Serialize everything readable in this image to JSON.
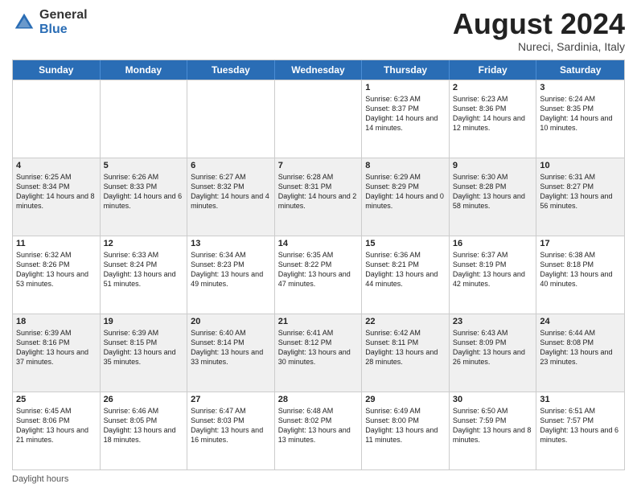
{
  "header": {
    "logo_general": "General",
    "logo_blue": "Blue",
    "title": "August 2024",
    "location": "Nureci, Sardinia, Italy"
  },
  "calendar": {
    "days_of_week": [
      "Sunday",
      "Monday",
      "Tuesday",
      "Wednesday",
      "Thursday",
      "Friday",
      "Saturday"
    ],
    "rows": [
      [
        {
          "day": "",
          "info": "",
          "empty": true
        },
        {
          "day": "",
          "info": "",
          "empty": true
        },
        {
          "day": "",
          "info": "",
          "empty": true
        },
        {
          "day": "",
          "info": "",
          "empty": true
        },
        {
          "day": "1",
          "info": "Sunrise: 6:23 AM\nSunset: 8:37 PM\nDaylight: 14 hours\nand 14 minutes.",
          "empty": false
        },
        {
          "day": "2",
          "info": "Sunrise: 6:23 AM\nSunset: 8:36 PM\nDaylight: 14 hours\nand 12 minutes.",
          "empty": false
        },
        {
          "day": "3",
          "info": "Sunrise: 6:24 AM\nSunset: 8:35 PM\nDaylight: 14 hours\nand 10 minutes.",
          "empty": false
        }
      ],
      [
        {
          "day": "4",
          "info": "Sunrise: 6:25 AM\nSunset: 8:34 PM\nDaylight: 14 hours\nand 8 minutes.",
          "empty": false
        },
        {
          "day": "5",
          "info": "Sunrise: 6:26 AM\nSunset: 8:33 PM\nDaylight: 14 hours\nand 6 minutes.",
          "empty": false
        },
        {
          "day": "6",
          "info": "Sunrise: 6:27 AM\nSunset: 8:32 PM\nDaylight: 14 hours\nand 4 minutes.",
          "empty": false
        },
        {
          "day": "7",
          "info": "Sunrise: 6:28 AM\nSunset: 8:31 PM\nDaylight: 14 hours\nand 2 minutes.",
          "empty": false
        },
        {
          "day": "8",
          "info": "Sunrise: 6:29 AM\nSunset: 8:29 PM\nDaylight: 14 hours\nand 0 minutes.",
          "empty": false
        },
        {
          "day": "9",
          "info": "Sunrise: 6:30 AM\nSunset: 8:28 PM\nDaylight: 13 hours\nand 58 minutes.",
          "empty": false
        },
        {
          "day": "10",
          "info": "Sunrise: 6:31 AM\nSunset: 8:27 PM\nDaylight: 13 hours\nand 56 minutes.",
          "empty": false
        }
      ],
      [
        {
          "day": "11",
          "info": "Sunrise: 6:32 AM\nSunset: 8:26 PM\nDaylight: 13 hours\nand 53 minutes.",
          "empty": false
        },
        {
          "day": "12",
          "info": "Sunrise: 6:33 AM\nSunset: 8:24 PM\nDaylight: 13 hours\nand 51 minutes.",
          "empty": false
        },
        {
          "day": "13",
          "info": "Sunrise: 6:34 AM\nSunset: 8:23 PM\nDaylight: 13 hours\nand 49 minutes.",
          "empty": false
        },
        {
          "day": "14",
          "info": "Sunrise: 6:35 AM\nSunset: 8:22 PM\nDaylight: 13 hours\nand 47 minutes.",
          "empty": false
        },
        {
          "day": "15",
          "info": "Sunrise: 6:36 AM\nSunset: 8:21 PM\nDaylight: 13 hours\nand 44 minutes.",
          "empty": false
        },
        {
          "day": "16",
          "info": "Sunrise: 6:37 AM\nSunset: 8:19 PM\nDaylight: 13 hours\nand 42 minutes.",
          "empty": false
        },
        {
          "day": "17",
          "info": "Sunrise: 6:38 AM\nSunset: 8:18 PM\nDaylight: 13 hours\nand 40 minutes.",
          "empty": false
        }
      ],
      [
        {
          "day": "18",
          "info": "Sunrise: 6:39 AM\nSunset: 8:16 PM\nDaylight: 13 hours\nand 37 minutes.",
          "empty": false
        },
        {
          "day": "19",
          "info": "Sunrise: 6:39 AM\nSunset: 8:15 PM\nDaylight: 13 hours\nand 35 minutes.",
          "empty": false
        },
        {
          "day": "20",
          "info": "Sunrise: 6:40 AM\nSunset: 8:14 PM\nDaylight: 13 hours\nand 33 minutes.",
          "empty": false
        },
        {
          "day": "21",
          "info": "Sunrise: 6:41 AM\nSunset: 8:12 PM\nDaylight: 13 hours\nand 30 minutes.",
          "empty": false
        },
        {
          "day": "22",
          "info": "Sunrise: 6:42 AM\nSunset: 8:11 PM\nDaylight: 13 hours\nand 28 minutes.",
          "empty": false
        },
        {
          "day": "23",
          "info": "Sunrise: 6:43 AM\nSunset: 8:09 PM\nDaylight: 13 hours\nand 26 minutes.",
          "empty": false
        },
        {
          "day": "24",
          "info": "Sunrise: 6:44 AM\nSunset: 8:08 PM\nDaylight: 13 hours\nand 23 minutes.",
          "empty": false
        }
      ],
      [
        {
          "day": "25",
          "info": "Sunrise: 6:45 AM\nSunset: 8:06 PM\nDaylight: 13 hours\nand 21 minutes.",
          "empty": false
        },
        {
          "day": "26",
          "info": "Sunrise: 6:46 AM\nSunset: 8:05 PM\nDaylight: 13 hours\nand 18 minutes.",
          "empty": false
        },
        {
          "day": "27",
          "info": "Sunrise: 6:47 AM\nSunset: 8:03 PM\nDaylight: 13 hours\nand 16 minutes.",
          "empty": false
        },
        {
          "day": "28",
          "info": "Sunrise: 6:48 AM\nSunset: 8:02 PM\nDaylight: 13 hours\nand 13 minutes.",
          "empty": false
        },
        {
          "day": "29",
          "info": "Sunrise: 6:49 AM\nSunset: 8:00 PM\nDaylight: 13 hours\nand 11 minutes.",
          "empty": false
        },
        {
          "day": "30",
          "info": "Sunrise: 6:50 AM\nSunset: 7:59 PM\nDaylight: 13 hours\nand 8 minutes.",
          "empty": false
        },
        {
          "day": "31",
          "info": "Sunrise: 6:51 AM\nSunset: 7:57 PM\nDaylight: 13 hours\nand 6 minutes.",
          "empty": false
        }
      ]
    ]
  },
  "footer": {
    "text": "Daylight hours"
  }
}
